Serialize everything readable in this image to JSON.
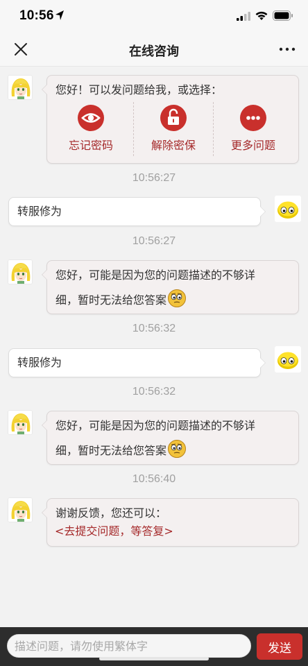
{
  "status_bar": {
    "time": "10:56"
  },
  "nav": {
    "title": "在线咨询"
  },
  "messages": [
    {
      "text": "您好！可以发问题给我，或选择：",
      "options": [
        {
          "label": "忘记密码",
          "icon": "eye-icon"
        },
        {
          "label": "解除密保",
          "icon": "unlock-icon"
        },
        {
          "label": "更多问题",
          "icon": "more-dots-icon"
        }
      ]
    },
    {
      "timestamp": "10:56:27"
    },
    {
      "text": "转服修为"
    },
    {
      "timestamp": "10:56:27"
    },
    {
      "line1": "您好，可能是因为您的问题描述的不够详",
      "line2": "细，暂时无法给您答案"
    },
    {
      "timestamp": "10:56:32"
    },
    {
      "text": "转服修为"
    },
    {
      "timestamp": "10:56:32"
    },
    {
      "line1": "您好，可能是因为您的问题描述的不够详",
      "line2": "细，暂时无法给您答案"
    },
    {
      "timestamp": "10:56:40"
    },
    {
      "line1": "谢谢反馈，您还可以：",
      "link": "<去提交问题，等答复>"
    }
  ],
  "input": {
    "placeholder": "描述问题，请勿使用繁体字",
    "send_label": "发送"
  },
  "colors": {
    "accent": "#c9302c",
    "link": "#a5292a",
    "input_bar": "#2d2d2d",
    "background": "#f2f2f2"
  }
}
